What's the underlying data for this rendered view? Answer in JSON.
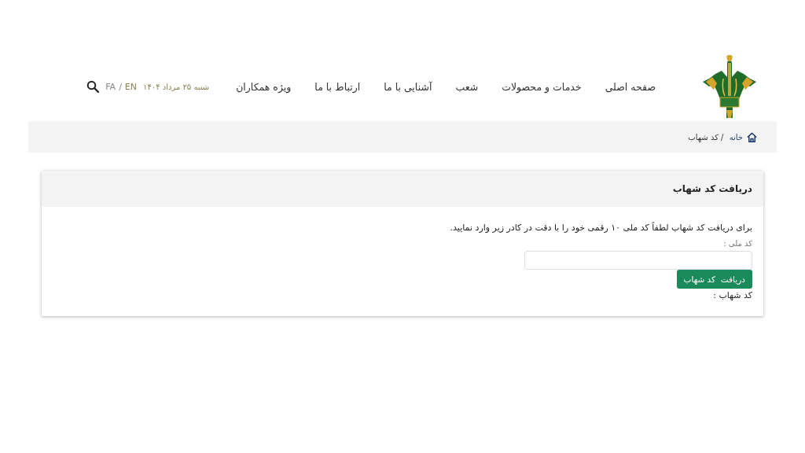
{
  "header": {
    "nav": [
      {
        "label": "صفحه اصلی"
      },
      {
        "label": "خدمات و محصولات"
      },
      {
        "label": "شعب"
      },
      {
        "label": "آشنایی با ما"
      },
      {
        "label": "ارتباط با ما"
      },
      {
        "label": "ویژه همکاران"
      }
    ],
    "date": "شنبه ۲۵ مرداد ۱۴۰۴",
    "languages": [
      {
        "label": "EN",
        "selected": false
      },
      {
        "label": "FA",
        "selected": true
      }
    ],
    "language_separator": "/"
  },
  "breadcrumb": {
    "home": "خانه",
    "current": " / کد شهاب"
  },
  "card": {
    "title": "دریافت کد شهاب",
    "instructions": "برای دریافت کد شهاب لطفاً کد ملی ۱۰ رقمی خود را با دقت در کادر زیر وارد نمایید.",
    "field_label": "کد ملی :",
    "button": "دریافت  کد شهاب",
    "result_label": "کد شهاب :"
  }
}
